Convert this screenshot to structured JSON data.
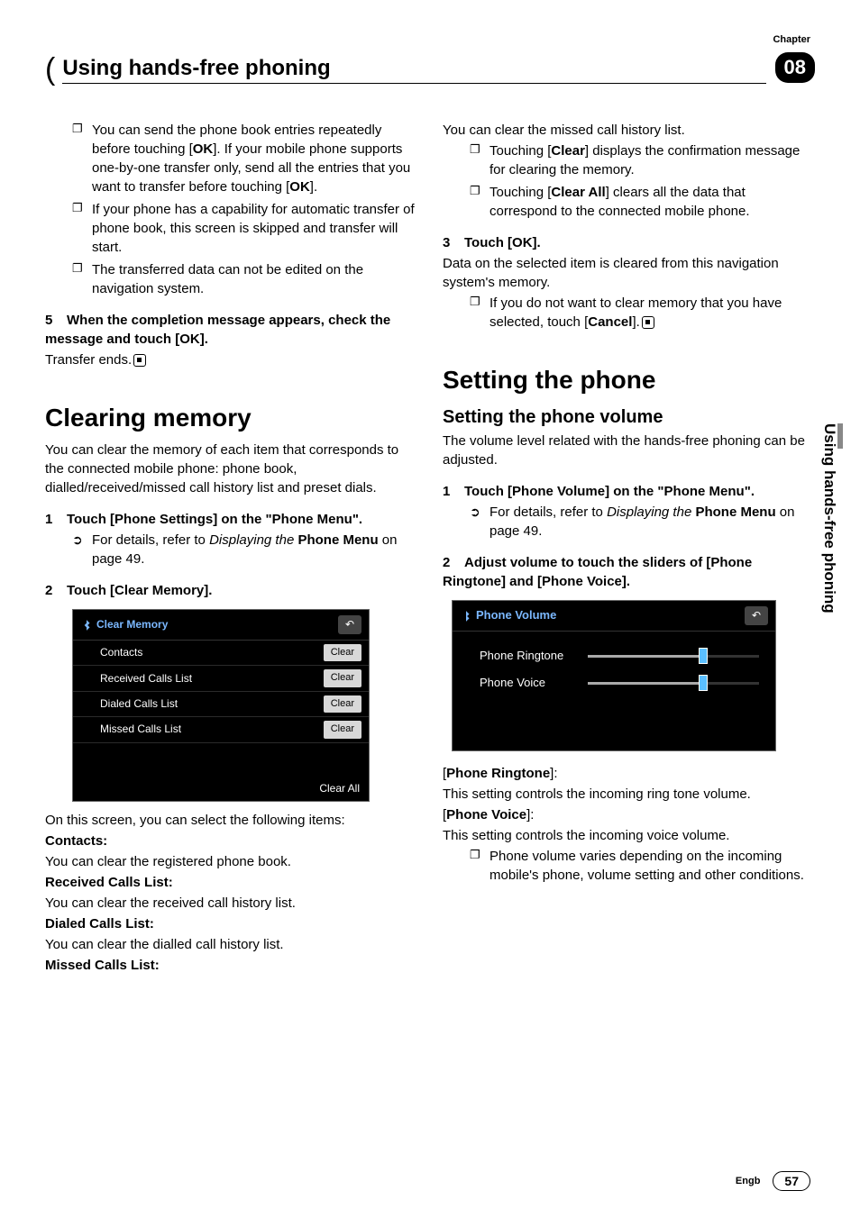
{
  "chapter_label": "Chapter",
  "chapter_num": "08",
  "header_title": "Using hands-free phoning",
  "side_label": "Using hands-free phoning",
  "footer_lang": "Engb",
  "page_number": "57",
  "left": {
    "pre_bullets": [
      "You can send the phone book entries repeatedly before touching [OK]. If your mobile phone supports one-by-one transfer only, send all the entries that you want to transfer before touching [OK].",
      "If your phone has a capability for automatic transfer of phone book, this screen is skipped and transfer will start.",
      "The transferred data can not be edited on the navigation system."
    ],
    "step5_head": "When the completion message appears, check the message and touch [OK].",
    "step5_body": "Transfer ends.",
    "clearing_title": "Clearing memory",
    "clearing_intro": "You can clear the memory of each item that corresponds to the connected mobile phone: phone book, dialled/received/missed call history list and preset dials.",
    "step1_head": "Touch [Phone Settings] on the \"Phone Menu\".",
    "step1_ref_prefix": "For details, refer to ",
    "step1_ref_italic": "Displaying the",
    "step1_ref_bold": "Phone Menu",
    "step1_ref_suffix": " on page 49.",
    "step2_head": "Touch [Clear Memory].",
    "screenshot1": {
      "title": "Clear Memory",
      "rows": [
        {
          "label": "Contacts",
          "btn": "Clear"
        },
        {
          "label": "Received Calls List",
          "btn": "Clear"
        },
        {
          "label": "Dialed Calls List",
          "btn": "Clear"
        },
        {
          "label": "Missed Calls List",
          "btn": "Clear"
        }
      ],
      "footer": "Clear All"
    },
    "after_ss_intro": "On this screen, you can select the following items:",
    "items": [
      {
        "h": "Contacts:",
        "b": "You can clear the registered phone book."
      },
      {
        "h": "Received Calls List:",
        "b": "You can clear the received call history list."
      },
      {
        "h": "Dialed Calls List:",
        "b": "You can clear the dialled call history list."
      },
      {
        "h": "Missed Calls List:",
        "b": ""
      }
    ]
  },
  "right": {
    "missed_body": "You can clear the missed call history list.",
    "missed_bullets_1a": "Touching [",
    "missed_bullets_1b": "Clear",
    "missed_bullets_1c": "] displays the confirmation message for clearing the memory.",
    "missed_bullets_2a": "Touching [",
    "missed_bullets_2b": "Clear All",
    "missed_bullets_2c": "] clears all the data that correspond to the connected mobile phone.",
    "step3_head": "Touch [OK].",
    "step3_body": "Data on the selected item is cleared from this navigation system's memory.",
    "step3_bullet_a": "If you do not want to clear memory that you have selected, touch [",
    "step3_bullet_b": "Cancel",
    "step3_bullet_c": "].",
    "setting_title": "Setting the phone",
    "setting_sub": "Setting the phone volume",
    "setting_intro": "The volume level related with the hands-free phoning can be adjusted.",
    "r_step1_head": "Touch [Phone Volume] on the \"Phone Menu\".",
    "r_step1_ref_prefix": "For details, refer to ",
    "r_step1_ref_italic": "Displaying the",
    "r_step1_ref_bold": "Phone Menu",
    "r_step1_ref_suffix": " on page 49.",
    "r_step2_head": "Adjust volume to touch the sliders of [Phone Ringtone] and [Phone Voice].",
    "screenshot2": {
      "title": "Phone Volume",
      "rows": [
        "Phone Ringtone",
        "Phone Voice"
      ]
    },
    "ringtone_h": "Phone Ringtone",
    "ringtone_b": "This setting controls the incoming ring tone volume.",
    "voice_h": "Phone Voice",
    "voice_b": "This setting controls the incoming voice volume.",
    "voice_bullet": "Phone volume varies depending on the incoming mobile's phone, volume setting and other conditions."
  }
}
